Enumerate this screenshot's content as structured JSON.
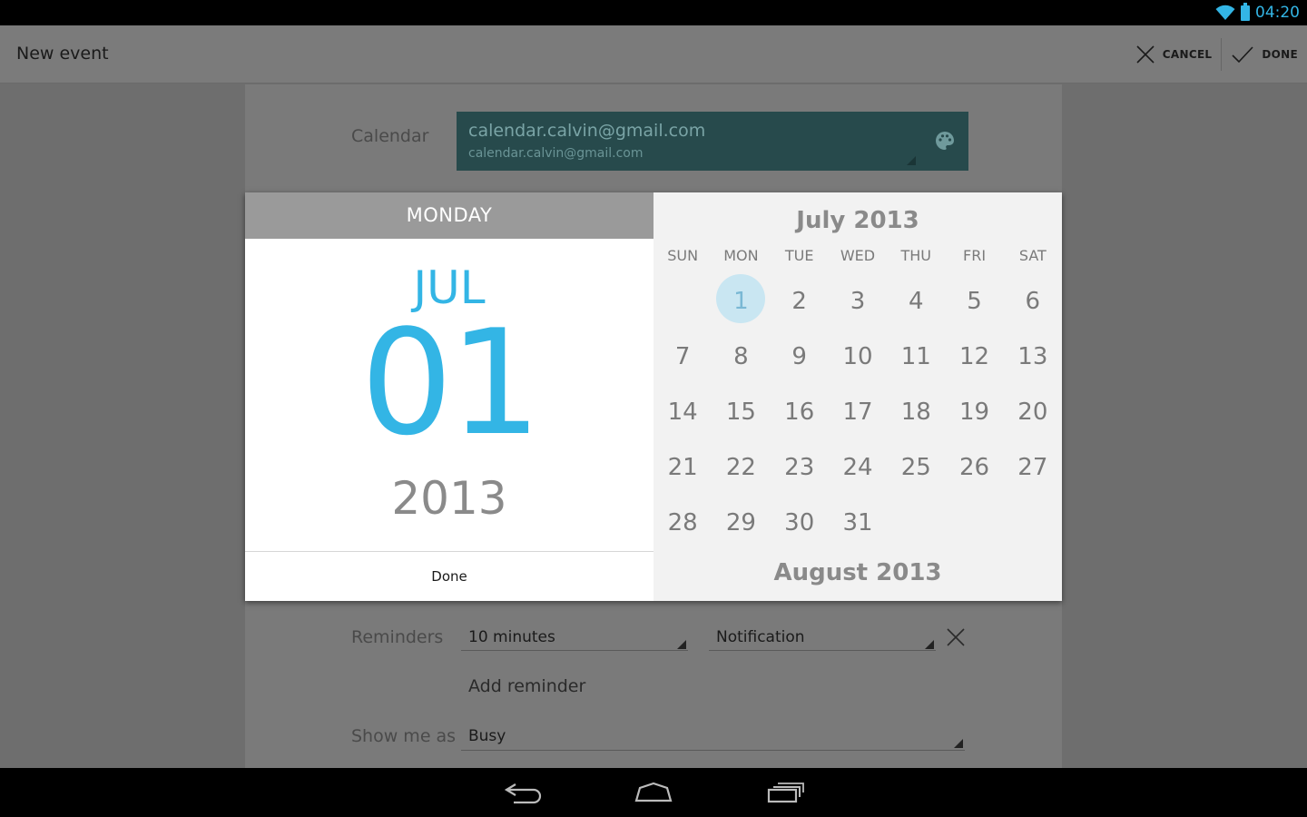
{
  "status_bar": {
    "time": "04:20"
  },
  "action_bar": {
    "title": "New event",
    "cancel_label": "CANCEL",
    "done_label": "DONE"
  },
  "form": {
    "calendar_label": "Calendar",
    "calendar_name": "calendar.calvin@gmail.com",
    "calendar_account": "calendar.calvin@gmail.com",
    "reminders_label": "Reminders",
    "reminder_time": "10 minutes",
    "reminder_method": "Notification",
    "add_reminder": "Add reminder",
    "show_me_as_label": "Show me as",
    "show_me_as_value": "Busy"
  },
  "date_picker": {
    "day_of_week": "MONDAY",
    "month": "JUL",
    "day": "01",
    "year": "2013",
    "done_label": "Done",
    "month_title": "July 2013",
    "next_month_title": "August 2013",
    "weekdays": [
      "SUN",
      "MON",
      "TUE",
      "WED",
      "THU",
      "FRI",
      "SAT"
    ],
    "weeks": [
      [
        "",
        "1",
        "2",
        "3",
        "4",
        "5",
        "6"
      ],
      [
        "7",
        "8",
        "9",
        "10",
        "11",
        "12",
        "13"
      ],
      [
        "14",
        "15",
        "16",
        "17",
        "18",
        "19",
        "20"
      ],
      [
        "21",
        "22",
        "23",
        "24",
        "25",
        "26",
        "27"
      ],
      [
        "28",
        "29",
        "30",
        "31",
        "",
        "",
        ""
      ]
    ],
    "selected_day": "1",
    "accent_color": "#33b5e5"
  },
  "icons": [
    "wifi-icon",
    "battery-icon",
    "close-icon",
    "check-icon",
    "palette-icon",
    "back-icon",
    "home-icon",
    "recents-icon"
  ]
}
